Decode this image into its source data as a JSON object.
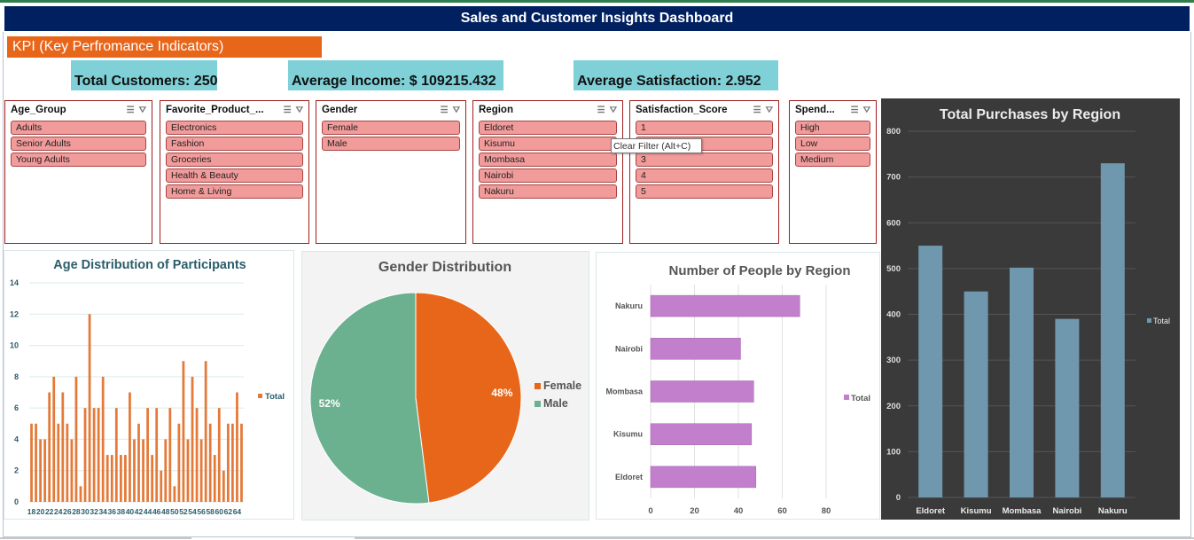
{
  "dashboard": {
    "title": "Sales and Customer Insights Dashboard",
    "kpi_header": "KPI (Key Perfromance Indicators)",
    "kpis": {
      "customers": "Total Customers: 250",
      "income": "Average Income: $ 109215.432",
      "satisfaction": "Average Satisfaction: 2.952"
    }
  },
  "slicers": [
    {
      "title": "Age_Group",
      "items": [
        "Adults",
        "Senior Adults",
        "Young Adults"
      ]
    },
    {
      "title": "Favorite_Product_...",
      "items": [
        "Electronics",
        "Fashion",
        "Groceries",
        "Health & Beauty",
        "Home & Living"
      ]
    },
    {
      "title": "Gender",
      "items": [
        "Female",
        "Male"
      ]
    },
    {
      "title": "Region",
      "items": [
        "Eldoret",
        "Kisumu",
        "Mombasa",
        "Nairobi",
        "Nakuru"
      ]
    },
    {
      "title": "Satisfaction_Score",
      "items": [
        "1",
        "2",
        "3",
        "4",
        "5"
      ]
    },
    {
      "title": "Spend...",
      "items": [
        "High",
        "Low",
        "Medium"
      ]
    }
  ],
  "tooltip": "Clear Filter (Alt+C)",
  "icons": [
    "multi-select-icon",
    "clear-filter-icon"
  ],
  "colors": {
    "header": "#002060",
    "kpi": "#7fd0d7",
    "accent": "#e8661a",
    "slicer_item": "#f19b9b",
    "region_bar": "#c17fcc",
    "purchase_bar": "#6f98ae"
  },
  "chart_data": [
    {
      "type": "bar",
      "title": "Age Distribution of Participants",
      "x_tick_labels": [
        "18",
        "20",
        "22",
        "24",
        "26",
        "28",
        "30",
        "32",
        "34",
        "36",
        "38",
        "40",
        "42",
        "44",
        "46",
        "48",
        "50",
        "52",
        "54",
        "56",
        "58",
        "60",
        "62",
        "64"
      ],
      "x": [
        18,
        19,
        20,
        21,
        22,
        23,
        24,
        25,
        26,
        27,
        28,
        29,
        30,
        31,
        32,
        33,
        34,
        35,
        36,
        37,
        38,
        39,
        40,
        41,
        42,
        43,
        44,
        45,
        46,
        47,
        48,
        49,
        50,
        51,
        52,
        53,
        54,
        55,
        56,
        57,
        58,
        59,
        60,
        61,
        62,
        63,
        64,
        65
      ],
      "series": [
        {
          "name": "Total",
          "values": [
            5,
            5,
            4,
            4,
            7,
            8,
            5,
            7,
            5,
            4,
            8,
            1,
            6,
            12,
            6,
            6,
            8,
            3,
            3,
            6,
            3,
            3,
            7,
            4,
            5,
            4,
            6,
            3,
            6,
            2,
            4,
            6,
            1,
            5,
            9,
            4,
            8,
            6,
            4,
            9,
            5,
            3,
            6,
            2,
            5,
            5,
            7,
            5
          ]
        }
      ],
      "ylim": [
        0,
        14
      ],
      "yticks": [
        0,
        2,
        4,
        6,
        8,
        10,
        12,
        14
      ],
      "legend": "right"
    },
    {
      "type": "pie",
      "title": "Gender Distribution",
      "categories": [
        "Female",
        "Male"
      ],
      "values": [
        48,
        52
      ],
      "data_labels": [
        "48%",
        "52%"
      ],
      "colors": [
        "#e8661a",
        "#6bb08f"
      ],
      "legend": "right"
    },
    {
      "type": "bar",
      "orientation": "horizontal",
      "title": "Number of People by Region",
      "categories": [
        "Eldoret",
        "Kisumu",
        "Mombasa",
        "Nairobi",
        "Nakuru"
      ],
      "series": [
        {
          "name": "Total",
          "values": [
            48,
            46,
            47,
            41,
            68
          ]
        }
      ],
      "xlim": [
        0,
        80
      ],
      "xticks": [
        0,
        20,
        40,
        60,
        80
      ],
      "legend": "right"
    },
    {
      "type": "bar",
      "title": "Total Purchases by Region",
      "categories": [
        "Eldoret",
        "Kisumu",
        "Mombasa",
        "Nairobi",
        "Nakuru"
      ],
      "series": [
        {
          "name": "Total",
          "values": [
            550,
            450,
            502,
            390,
            730
          ]
        }
      ],
      "ylim": [
        0,
        800
      ],
      "yticks": [
        0,
        100,
        200,
        300,
        400,
        500,
        600,
        700,
        800
      ],
      "legend": "right"
    }
  ]
}
